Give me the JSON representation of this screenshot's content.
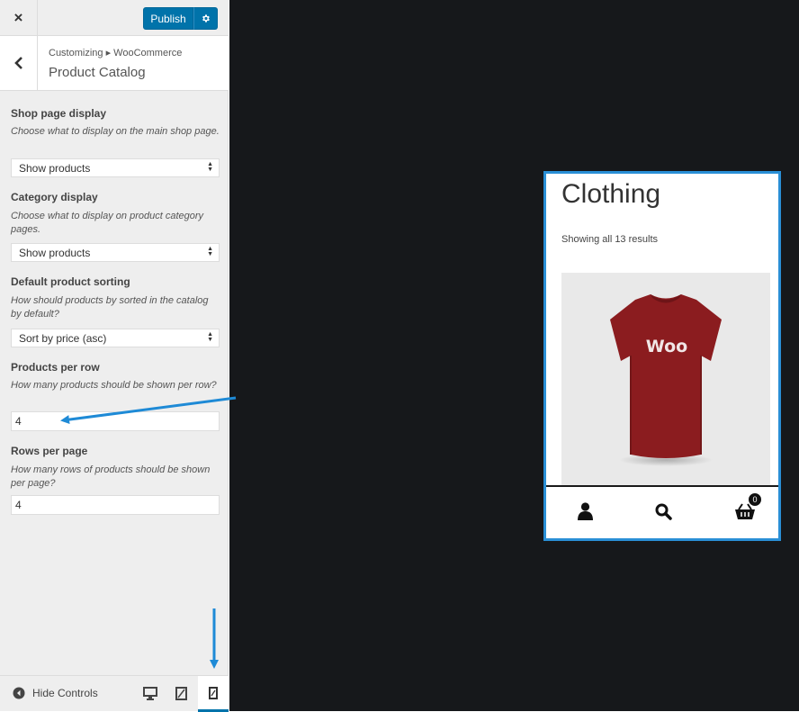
{
  "topbar": {
    "close_icon": "×",
    "publish_label": "Publish"
  },
  "header": {
    "breadcrumb": "Customizing ▸ WooCommerce",
    "title": "Product Catalog"
  },
  "controls": {
    "shop_display": {
      "label": "Shop page display",
      "desc": "Choose what to display on the main shop page.",
      "value": "Show products"
    },
    "category_display": {
      "label": "Category display",
      "desc": "Choose what to display on product category pages.",
      "value": "Show products"
    },
    "sorting": {
      "label": "Default product sorting",
      "desc": "How should products by sorted in the catalog by default?",
      "value": "Sort by price (asc)"
    },
    "per_row": {
      "label": "Products per row",
      "desc": "How many products should be shown per row?",
      "value": "4"
    },
    "rows_per_page": {
      "label": "Rows per page",
      "desc": "How many rows of products should be shown per page?",
      "value": "4"
    }
  },
  "footer": {
    "hide_controls": "Hide Controls"
  },
  "preview": {
    "title": "Clothing",
    "count_text": "Showing all 13 results",
    "product_logo_text": "Woo",
    "cart_count": "0"
  },
  "colors": {
    "accent": "#0073aa",
    "annotation": "#1e8ad6",
    "shirt": "#8b1c1f",
    "preview_bg": "#16181b"
  },
  "icons": [
    "close-icon",
    "gear-icon",
    "chevron-left-icon",
    "select-arrows-icon",
    "circle-left-icon",
    "desktop-icon",
    "tablet-icon",
    "mobile-icon",
    "user-icon",
    "search-icon",
    "cart-icon"
  ]
}
